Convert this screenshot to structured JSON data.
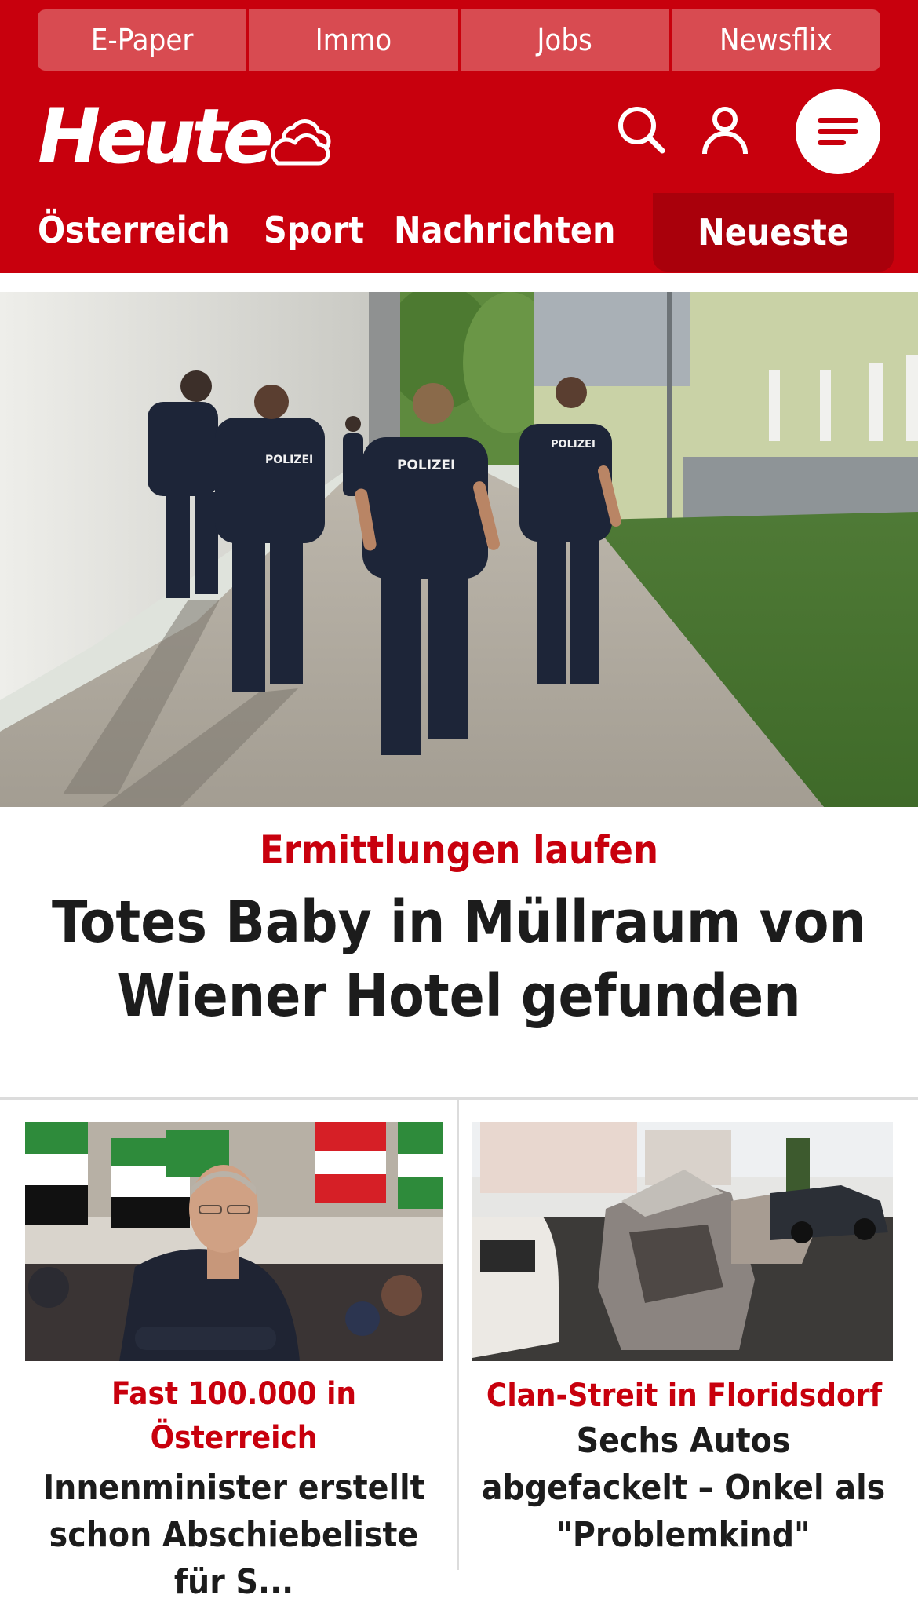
{
  "quicklinks": [
    "E-Paper",
    "Immo",
    "Jobs",
    "Newsflix"
  ],
  "header": {
    "logo": "Heute",
    "weather_icon": "cloud-sun-icon",
    "search_icon": "search-icon",
    "account_icon": "user-icon",
    "menu_icon": "hamburger-menu-icon"
  },
  "nav": {
    "items": [
      "Österreich",
      "Sport",
      "Nachrichten"
    ],
    "active": "Neueste"
  },
  "hero": {
    "image_text_1": "POLIZEI",
    "image_text_2": "POLIZEI",
    "image_text_3": "POLIZEI",
    "kicker": "Ermittlungen laufen",
    "title": "Totes Baby in Müllraum von Wiener Hotel gefunden"
  },
  "teasers": [
    {
      "kicker": "Fast 100.000 in Österreich",
      "title": "Innenminister erstellt schon Abschiebeliste für S..."
    },
    {
      "kicker": "Clan-Streit in Floridsdorf",
      "title": "Sechs Autos abgefackelt – Onkel als \"Problemkind\""
    }
  ],
  "colors": {
    "brand_red": "#c8000d",
    "quicklink_bg": "#d84b51",
    "nav_active_bg": "#a9000b",
    "headline_text": "#1c1c1c"
  }
}
